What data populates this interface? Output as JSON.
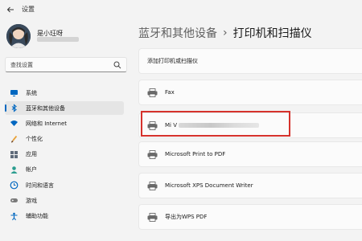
{
  "window": {
    "title": "设置"
  },
  "user": {
    "name": "是小玨呀"
  },
  "search": {
    "placeholder": "查找设置"
  },
  "sidebar": {
    "items": [
      {
        "label": "系统",
        "icon": "monitor-icon",
        "color": "#0067c0"
      },
      {
        "label": "蓝牙和其他设备",
        "icon": "bluetooth-icon",
        "color": "#0067c0",
        "selected": true
      },
      {
        "label": "网络和 Internet",
        "icon": "wifi-icon",
        "color": "#0067c0"
      },
      {
        "label": "个性化",
        "icon": "brush-icon",
        "color": "#e8a33d"
      },
      {
        "label": "应用",
        "icon": "apps-icon",
        "color": "#5f6b7a"
      },
      {
        "label": "帐户",
        "icon": "account-icon",
        "color": "#2a9d8f"
      },
      {
        "label": "时间和语言",
        "icon": "globe-clock-icon",
        "color": "#0067c0"
      },
      {
        "label": "游戏",
        "icon": "gamepad-icon",
        "color": "#7a7a7a"
      },
      {
        "label": "辅助功能",
        "icon": "accessibility-icon",
        "color": "#0067c0"
      }
    ]
  },
  "breadcrumb": {
    "parent": "蓝牙和其他设备",
    "separator": "›",
    "current": "打印机和扫描仪"
  },
  "main": {
    "add_label": "添加打印机或扫描仪",
    "printers": [
      {
        "label": "Fax",
        "redacted": false
      },
      {
        "label": "Mi V",
        "redacted": true,
        "highlighted": true
      },
      {
        "label": "Microsoft Print to PDF",
        "redacted": false
      },
      {
        "label": "Microsoft XPS Document Writer",
        "redacted": false
      },
      {
        "label": "导出为WPS PDF",
        "redacted": false
      }
    ]
  },
  "colors": {
    "accent": "#0067c0",
    "highlight_box": "#d6322c"
  }
}
